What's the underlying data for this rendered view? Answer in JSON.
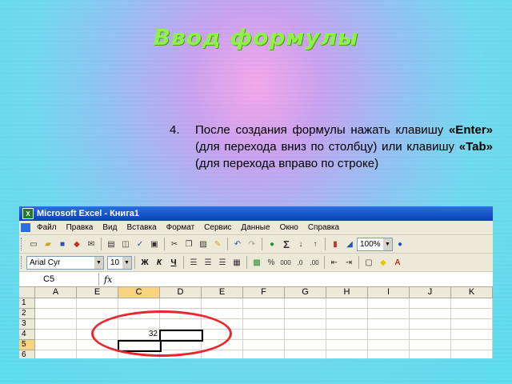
{
  "slide": {
    "title": "Ввод формулы",
    "step_number": "4.",
    "step_text_1": "После создания формулы нажать клавишу ",
    "step_key_1": "«Enter»",
    "step_text_2": " (для перехода вниз по столбцу) или клавишу ",
    "step_key_2": "«Tab»",
    "step_text_3": " (для перехода вправо по строке)"
  },
  "excel": {
    "window_title": "Microsoft Excel - Книга1",
    "menu": [
      "Файл",
      "Правка",
      "Вид",
      "Вставка",
      "Формат",
      "Сервис",
      "Данные",
      "Окно",
      "Справка"
    ],
    "zoom": "100%",
    "font_name": "Arial Cyr",
    "font_size": "10",
    "bold": "Ж",
    "italic": "К",
    "underline": "Ч",
    "sigma": "Σ",
    "name_box": "C5",
    "fx": "fx",
    "columns": [
      "A",
      "E",
      "C",
      "D",
      "E",
      "F",
      "G",
      "H",
      "I",
      "J",
      "K"
    ],
    "rows": [
      "1",
      "2",
      "3",
      "4",
      "5",
      "6"
    ],
    "cell_value": "32",
    "selected_column": "C",
    "selected_row": "5",
    "colors": {
      "title_green": "#8ff04a",
      "ellipse_red": "#e8262c",
      "excel_titlebar": "#0a3fb8"
    }
  }
}
